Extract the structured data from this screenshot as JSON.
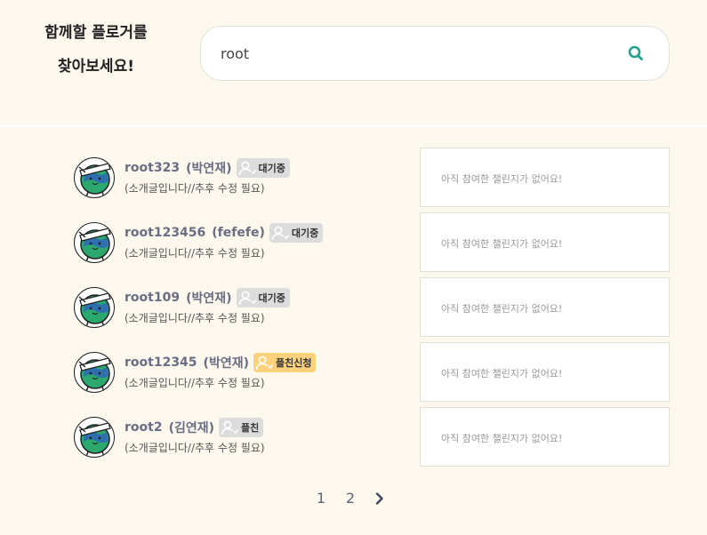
{
  "header": {
    "tagline_line1": "함께할 플로거를",
    "tagline_line2": "찾아보세요!"
  },
  "search": {
    "value": "root",
    "icon": "search-icon"
  },
  "colors": {
    "background": "#fcf8ee",
    "accent": "#1aa58a",
    "badge_default": "#dcdcdc",
    "badge_request": "#fdd27a",
    "name": "#6a6e84"
  },
  "users": [
    {
      "username": "root323",
      "realname": "(박연재)",
      "badge": "대기중",
      "badge_type": "waiting",
      "intro": "(소개글입니다//추후 수정 필요)",
      "challenge": "아직 참여한 챌린지가 없어요!"
    },
    {
      "username": "root123456",
      "realname": "(fefefe)",
      "badge": "대기중",
      "badge_type": "waiting",
      "intro": "(소개글입니다//추후 수정 필요)",
      "challenge": "아직 참여한 챌린지가 없어요!"
    },
    {
      "username": "root109",
      "realname": "(박연재)",
      "badge": "대기중",
      "badge_type": "waiting",
      "intro": "(소개글입니다//추후 수정 필요)",
      "challenge": "아직 참여한 챌린지가 없어요!"
    },
    {
      "username": "root12345",
      "realname": "(박연재)",
      "badge": "플친신청",
      "badge_type": "request",
      "intro": "(소개글입니다//추후 수정 필요)",
      "challenge": "아직 참여한 챌린지가 없어요!"
    },
    {
      "username": "root2",
      "realname": "(김연재)",
      "badge": "플친",
      "badge_type": "friend",
      "intro": "(소개글입니다//추후 수정 필요)",
      "challenge": "아직 참여한 챌린지가 없어요!"
    }
  ],
  "pagination": {
    "pages": [
      "1",
      "2"
    ],
    "next_icon": "chevron-right-icon"
  }
}
